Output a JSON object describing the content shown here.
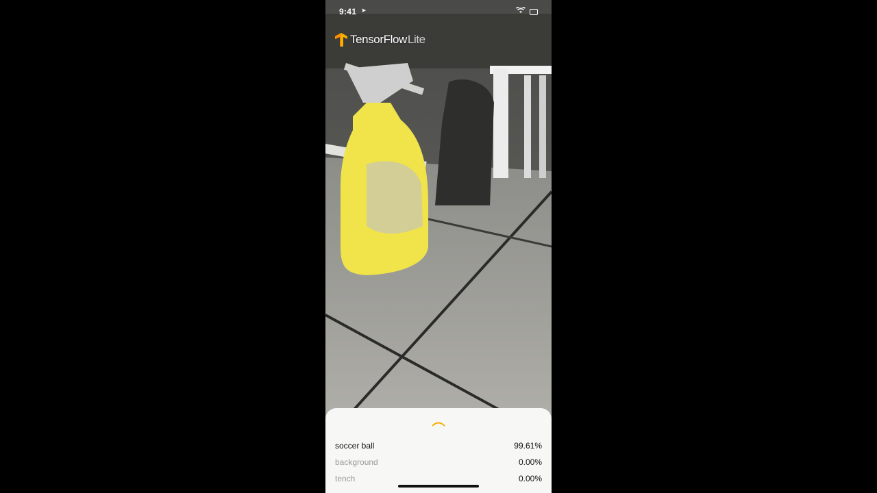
{
  "status_bar": {
    "time": "9:41",
    "location_icon": "location-arrow-icon",
    "wifi_icon": "wifi-icon",
    "battery_icon": "battery-icon"
  },
  "logo": {
    "name": "TensorFlow",
    "suffix": "Lite",
    "icon": "tensorflow-logo-icon",
    "accent": "#F5B100"
  },
  "camera": {
    "description_icon": "camera-feed"
  },
  "results": {
    "handle_icon": "chevron-up-icon",
    "items": [
      {
        "label": "soccer ball",
        "score": "99.61%"
      },
      {
        "label": "background",
        "score": "0.00%"
      },
      {
        "label": "tench",
        "score": "0.00%"
      }
    ]
  },
  "colors": {
    "sheet_bg": "#f7f7f5",
    "bottle_yellow": "#f0e44a"
  }
}
